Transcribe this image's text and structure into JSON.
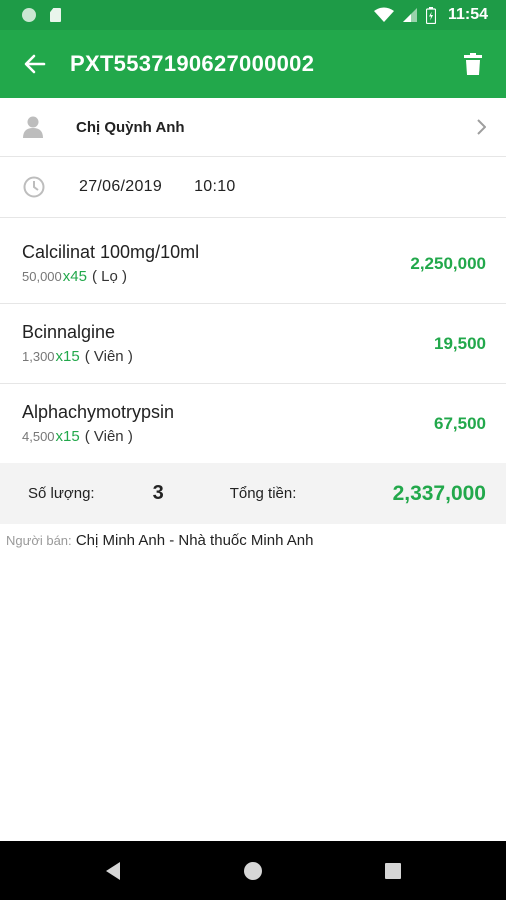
{
  "status_bar": {
    "time": "11:54"
  },
  "header": {
    "title": "PXT5537190627000002"
  },
  "customer": {
    "name": "Chị Quỳnh Anh"
  },
  "datetime": {
    "date": "27/06/2019",
    "time": "10:10"
  },
  "items": [
    {
      "name": "Calcilinat 100mg/10ml",
      "price": "50,000",
      "qty": "x45",
      "unit": "( Lọ )",
      "total": "2,250,000"
    },
    {
      "name": "Bcinnalgine",
      "price": "1,300",
      "qty": "x15",
      "unit": "( Viên )",
      "total": "19,500"
    },
    {
      "name": "Alphachymotrypsin",
      "price": "4,500",
      "qty": "x15",
      "unit": "( Viên )",
      "total": "67,500"
    }
  ],
  "summary": {
    "quantity_label": "Số lượng:",
    "quantity_value": "3",
    "total_label": "Tổng tiền:",
    "total_value": "2,337,000"
  },
  "seller": {
    "label": "Người bán:",
    "value": "Chị Minh Anh - Nhà thuốc Minh Anh"
  },
  "colors": {
    "primary": "#22a84b",
    "status_bar": "#1e9b47",
    "summary_bg": "#f3f3f3"
  },
  "icons": [
    "back-arrow-icon",
    "trash-icon",
    "person-icon",
    "chevron-right-icon",
    "clock-icon",
    "wifi-icon",
    "signal-icon",
    "battery-icon",
    "nav-back-icon",
    "nav-home-icon",
    "nav-recents-icon"
  ]
}
